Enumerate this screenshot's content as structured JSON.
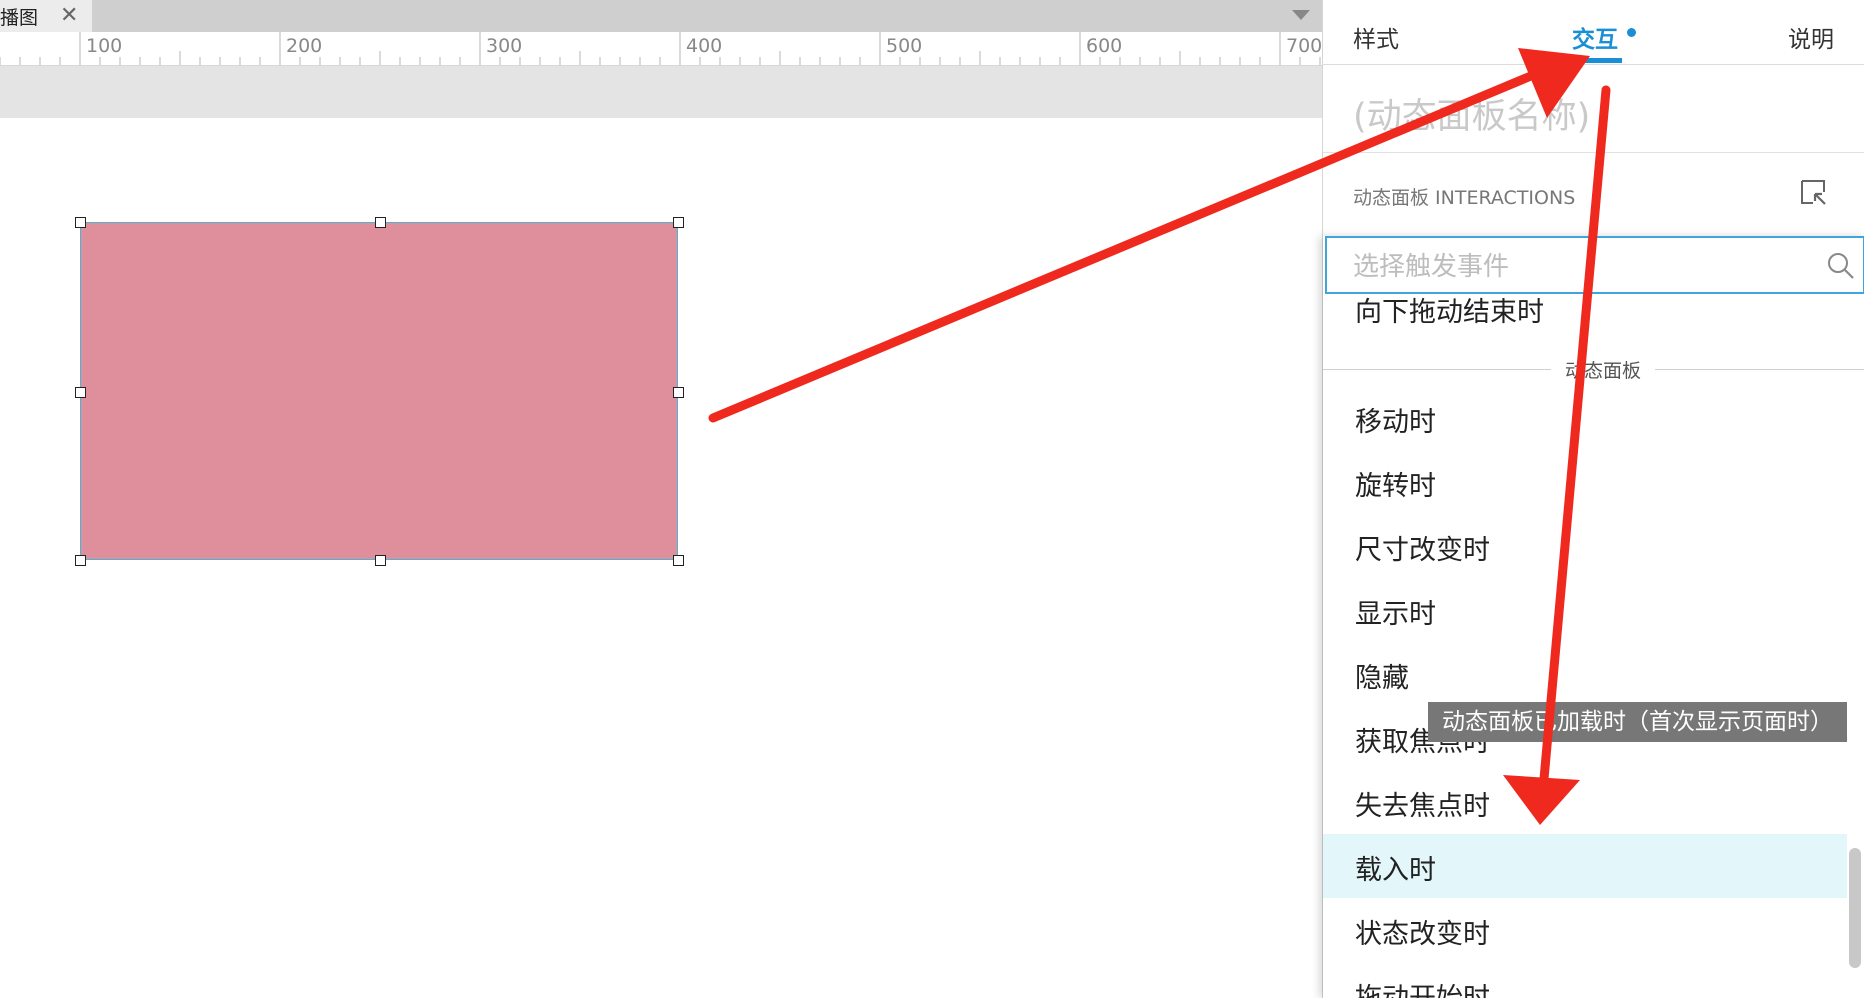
{
  "tab": {
    "label": "播图",
    "close": "✕"
  },
  "ruler": {
    "labels": [
      "100",
      "200",
      "300",
      "400",
      "500",
      "600",
      "700"
    ]
  },
  "inspector": {
    "tabs": {
      "style": "样式",
      "interactions": "交互",
      "notes": "说明"
    },
    "widget_name_placeholder": "(动态面板名称)",
    "interactions_title": "动态面板 INTERACTIONS",
    "search_placeholder": "选择触发事件",
    "group_label": "动态面板",
    "items": [
      "向下拖动结束时",
      "移动时",
      "旋转时",
      "尺寸改变时",
      "显示时",
      "隐藏",
      "获取焦点时",
      "失去焦点时",
      "载入时",
      "状态改变时",
      "拖动开始时"
    ],
    "highlighted_item": "载入时",
    "tooltip": "动态面板已加载时（首次显示页面时）"
  },
  "colors": {
    "accent": "#1b8fd6",
    "panel_fill": "#de8f9b",
    "selection_border": "#4ab5d6",
    "highlight": "#e3f7fa",
    "arrow": "#f0291f"
  },
  "icons": [
    "close-icon",
    "dropdown-caret-icon",
    "interactions-expand-icon",
    "search-icon"
  ]
}
